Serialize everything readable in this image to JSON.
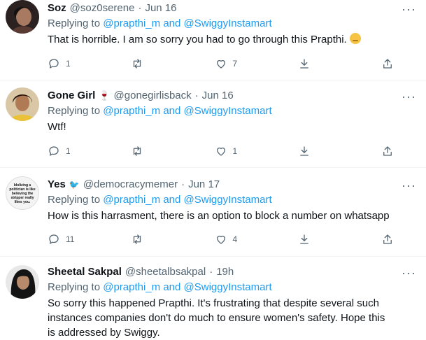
{
  "tweets": [
    {
      "name": "Soz",
      "handle": "@soz0serene",
      "dot": "·",
      "time": "Jun 16",
      "replying_prefix": "Replying to",
      "mentions": "@prapthi_m and @SwiggyInstamart",
      "text": "That is horrible. I am so sorry you had to go through this Prapthi.",
      "replies": "1",
      "retweets": "",
      "likes": "7"
    },
    {
      "name": "Gone Girl",
      "name_emoji": "🍷",
      "handle": "@gonegirlisback",
      "dot": "·",
      "time": "Jun 16",
      "replying_prefix": "Replying to",
      "mentions": "@prapthi_m and @SwiggyInstamart",
      "text": "Wtf!",
      "replies": "1",
      "retweets": "",
      "likes": "1"
    },
    {
      "name": "Yes",
      "name_emoji": "🐦",
      "handle": "@democracymemer",
      "dot": "·",
      "time": "Jun 17",
      "replying_prefix": "Replying to",
      "mentions": "@prapthi_m and @SwiggyInstamart",
      "text": "How is this harrasment, there is an option to block a number on whatsapp",
      "replies": "11",
      "retweets": "",
      "likes": "4",
      "avatar_text": "Idolizing a politician is like believing the stripper really likes you."
    },
    {
      "name": "Sheetal Sakpal",
      "handle": "@sheetalbsakpal",
      "dot": "·",
      "time": "19h",
      "replying_prefix": "Replying to",
      "mentions": "@prapthi_m and @SwiggyInstamart",
      "text": "So sorry this happened Prapthi. It's frustrating that despite several such instances companies don't do much to ensure women's safety. Hope this is addressed by Swiggy.",
      "replies": "",
      "retweets": "",
      "likes": ""
    }
  ],
  "more_glyph": "···",
  "icons": [
    "reply-icon",
    "retweet-icon",
    "like-icon",
    "download-icon",
    "share-icon"
  ],
  "colors": {
    "link": "#1d9bf0",
    "secondary": "#536471",
    "text": "#0f1419"
  }
}
